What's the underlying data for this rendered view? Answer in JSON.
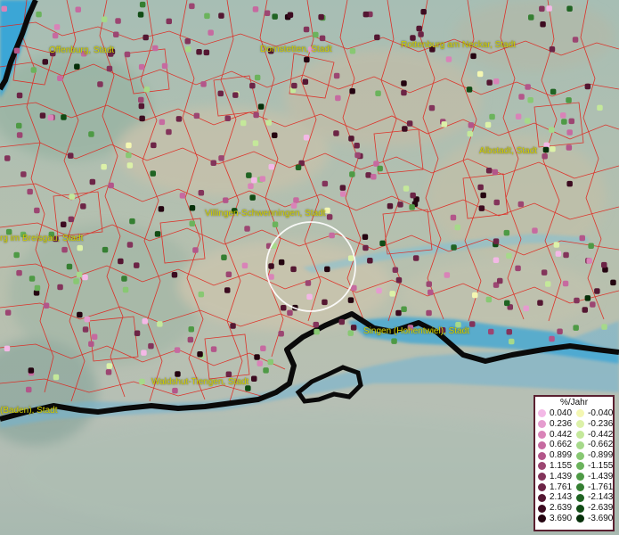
{
  "map": {
    "cities": [
      {
        "name": "Offenburg, Stadt"
      },
      {
        "name": "Dornstetten, Stadt"
      },
      {
        "name": "Rottenburg am Neckar, Stadt"
      },
      {
        "name": "Albstadt, Stadt"
      },
      {
        "name": "Villingen-Schwenningen, Stadt"
      },
      {
        "name": "rg im Breisgau, Stadt"
      },
      {
        "name": "Singen (Hohentwiel), Stadt"
      },
      {
        "name": "Waldshut-Tiengen, Stadt"
      },
      {
        "name": "(Baden), Stadt"
      }
    ],
    "colors": {
      "boundary": "#e0241c",
      "border": "#0a0a0a",
      "lake": "#3aa6d6",
      "selection_ring": "#ffffff",
      "label": "#d6d200"
    }
  },
  "legend": {
    "title": "%/Jahr",
    "rows": [
      {
        "pos": "0.040",
        "pos_color": "#f3b8e6",
        "neg": "-0.040",
        "neg_color": "#f4f7b2"
      },
      {
        "pos": "0.236",
        "pos_color": "#e59ccf",
        "neg": "-0.236",
        "neg_color": "#dcf1a8"
      },
      {
        "pos": "0.442",
        "pos_color": "#d983b8",
        "neg": "-0.442",
        "neg_color": "#c4e89a"
      },
      {
        "pos": "0.662",
        "pos_color": "#c66aa0",
        "neg": "-0.662",
        "neg_color": "#a6d98a"
      },
      {
        "pos": "0.899",
        "pos_color": "#b3568a",
        "neg": "-0.899",
        "neg_color": "#88c873"
      },
      {
        "pos": "1.155",
        "pos_color": "#9c4672",
        "neg": "-1.155",
        "neg_color": "#6bb35c"
      },
      {
        "pos": "1.439",
        "pos_color": "#83345b",
        "neg": "-1.439",
        "neg_color": "#4e9a45"
      },
      {
        "pos": "1.761",
        "pos_color": "#6c2446",
        "neg": "-1.761",
        "neg_color": "#357f32"
      },
      {
        "pos": "2.143",
        "pos_color": "#541732",
        "neg": "-2.143",
        "neg_color": "#206423"
      },
      {
        "pos": "2.639",
        "pos_color": "#3c0b20",
        "neg": "-2.639",
        "neg_color": "#114c15"
      },
      {
        "pos": "3.690",
        "pos_color": "#240410",
        "neg": "-3.690",
        "neg_color": "#06300a"
      }
    ]
  }
}
